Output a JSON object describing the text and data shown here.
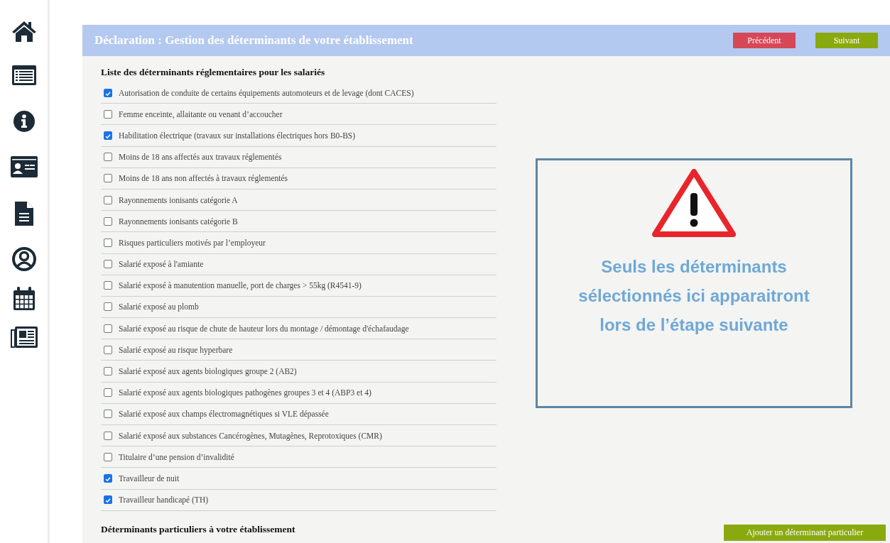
{
  "sidebar": {
    "items": [
      {
        "kind": "home"
      },
      {
        "kind": "list"
      },
      {
        "kind": "info"
      },
      {
        "kind": "id-card"
      },
      {
        "kind": "document"
      },
      {
        "kind": "user"
      },
      {
        "kind": "calendar"
      },
      {
        "kind": "newspaper"
      }
    ]
  },
  "header": {
    "title": "Déclaration : Gestion des déterminants de votre établissement",
    "buttons": [
      {
        "label": "Précédent",
        "kind": "previous"
      },
      {
        "label": "Suivant",
        "kind": "next"
      }
    ]
  },
  "list": {
    "title": "Liste des déterminants réglementaires pour les salariés",
    "items": [
      {
        "label": "Autorisation de conduite de certains équipements automoteurs et de levage (dont CACES)",
        "checked": true
      },
      {
        "label": "Femme enceinte, allaitante ou venant d’accoucher",
        "checked": false
      },
      {
        "label": "Habilitation électrique (travaux sur installations électriques hors B0-BS)",
        "checked": true
      },
      {
        "label": "Moins de 18 ans affectés aux travaux réglementés",
        "checked": false
      },
      {
        "label": "Moins de 18 ans non affectés à travaux réglementés",
        "checked": false
      },
      {
        "label": "Rayonnements ionisants catégorie A",
        "checked": false
      },
      {
        "label": "Rayonnements ionisants catégorie B",
        "checked": false
      },
      {
        "label": "Risques particuliers motivés par l’employeur",
        "checked": false
      },
      {
        "label": "Salarié exposé à l'amiante",
        "checked": false
      },
      {
        "label": "Salarié exposé à manutention manuelle, port de charges > 55kg (R4541-9)",
        "checked": false
      },
      {
        "label": "Salarié exposé au plomb",
        "checked": false
      },
      {
        "label": "Salarié exposé au risque de chute de hauteur lors du montage / démontage d'échafaudage",
        "checked": false
      },
      {
        "label": "Salarié exposé au risque hyperbare",
        "checked": false
      },
      {
        "label": "Salarié exposé aux agents biologiques groupe 2 (AB2)",
        "checked": false
      },
      {
        "label": "Salarié exposé aux agents biologiques pathogènes groupes 3 et 4 (ABP3 et 4)",
        "checked": false
      },
      {
        "label": "Salarié exposé aux champs électromagnétiques si VLE dépassée",
        "checked": false
      },
      {
        "label": "Salarié exposé aux substances Cancérogènes, Mutagènes, Reprotoxiques (CMR)",
        "checked": false
      },
      {
        "label": "Titulaire d’une pension d’invalidité",
        "checked": false
      },
      {
        "label": "Travailleur de nuit",
        "checked": true
      },
      {
        "label": "Travailleur handicapé (TH)",
        "checked": true
      }
    ]
  },
  "callout": {
    "text": "Seuls les déterminants sélectionnés ici apparaitront lors de l’étape suivante"
  },
  "particular": {
    "title": "Déterminants particuliers à votre établissement",
    "button": "Ajouter un déterminant particulier"
  }
}
